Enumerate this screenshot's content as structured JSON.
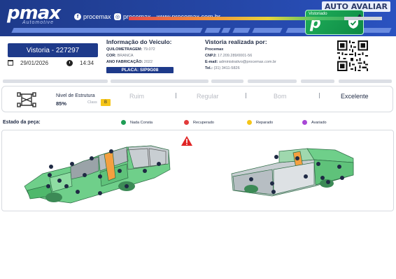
{
  "header": {
    "logo": "pmax",
    "logo_sub": "Automotive",
    "facebook": "procemax",
    "instagram": "procemax",
    "website": "www.procemax.com.br",
    "brand_tag": "AUTO AVALIAR",
    "badge_label": "Vistoriado",
    "badge_letter": "p"
  },
  "vistoria": {
    "label": "Vistoria - 227297",
    "date": "29/01/2026",
    "time": "14:34"
  },
  "vehicle": {
    "title": "Informação do Veiculo:",
    "quilometragem_label": "QUILOMETRAGEM:",
    "quilometragem": "79.072",
    "cor_label": "COR:",
    "cor": "BRANCA",
    "ano_label": "ANO FABRICAÇÃO:",
    "ano": "2022",
    "placa": "PLACA: SIP9G08"
  },
  "realizada": {
    "title": "Vistoria realizada por:",
    "company": "Procemax",
    "cnpj_label": "CNPJ:",
    "cnpj": "17.209.289/0001-56",
    "email_label": "E-mail:",
    "email": "administrativo@procemax.com.br",
    "tel_label": "Tel.:",
    "tel": "(31) 3411-5826"
  },
  "estrutura": {
    "label": "Nivel de Estrutura",
    "value": "85%",
    "classe_label": "Class",
    "classe": "B",
    "scale": [
      "Ruim",
      "Regular",
      "Bom",
      "Excelente"
    ],
    "active": "Excelente",
    "level_fraction": 0.85
  },
  "legend": {
    "title": "Estado da peça:",
    "items": [
      {
        "label": "Nada Consta",
        "color": "#1f9d55"
      },
      {
        "label": "Recuperado",
        "color": "#e23b3b"
      },
      {
        "label": "Reparado",
        "color": "#f5c518"
      },
      {
        "label": "Avariado",
        "color": "#a847d6"
      }
    ]
  },
  "colors": {
    "brand": "#1e3a8a",
    "ok": "#3cb371",
    "repaired": "#f4a040",
    "warning": "#e02424"
  }
}
